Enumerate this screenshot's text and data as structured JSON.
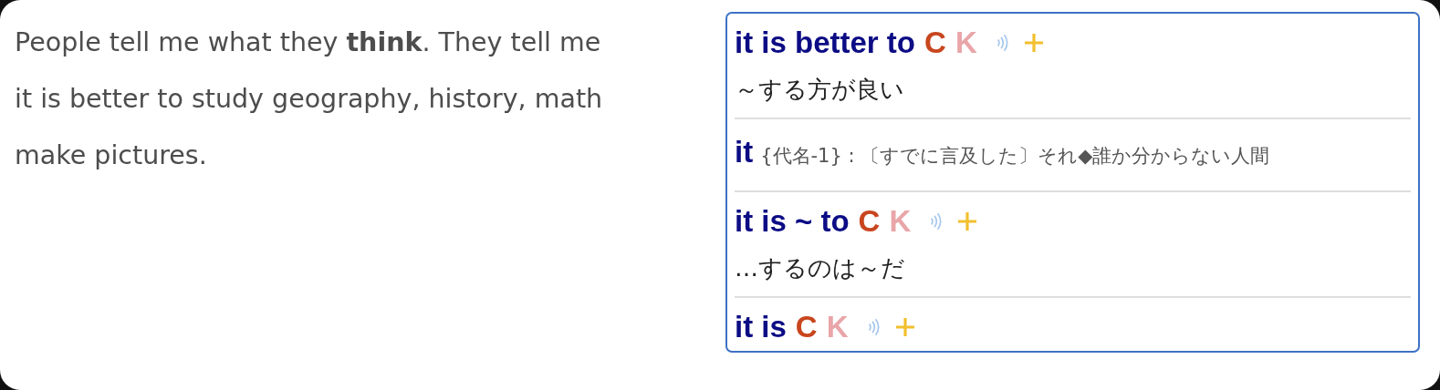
{
  "paragraph": {
    "lines": [
      "People tell me what they **think**. They tell me",
      "it is better to study geography, history, math",
      "make pictures."
    ]
  },
  "popup": {
    "entries": [
      {
        "kind": "phrase",
        "headword": "it is better to",
        "badges": [
          {
            "label": "C",
            "color": "#c8461e"
          },
          {
            "label": "K",
            "color": "#e9a5a8"
          }
        ],
        "meaning": "～する方が良い"
      },
      {
        "kind": "word",
        "headword": "it",
        "definition": "{代名-1} : 〔すでに言及した〕それ◆誰か分からない人間"
      },
      {
        "kind": "phrase",
        "headword": "it is ~ to",
        "badges": [
          {
            "label": "C",
            "color": "#c8461e"
          },
          {
            "label": "K",
            "color": "#e9a5a8"
          }
        ],
        "meaning": "…するのは～だ"
      },
      {
        "kind": "phrase",
        "headword": "it is",
        "badges": [
          {
            "label": "C",
            "color": "#c8461e"
          },
          {
            "label": "K",
            "color": "#e9a5a8"
          }
        ]
      }
    ]
  }
}
